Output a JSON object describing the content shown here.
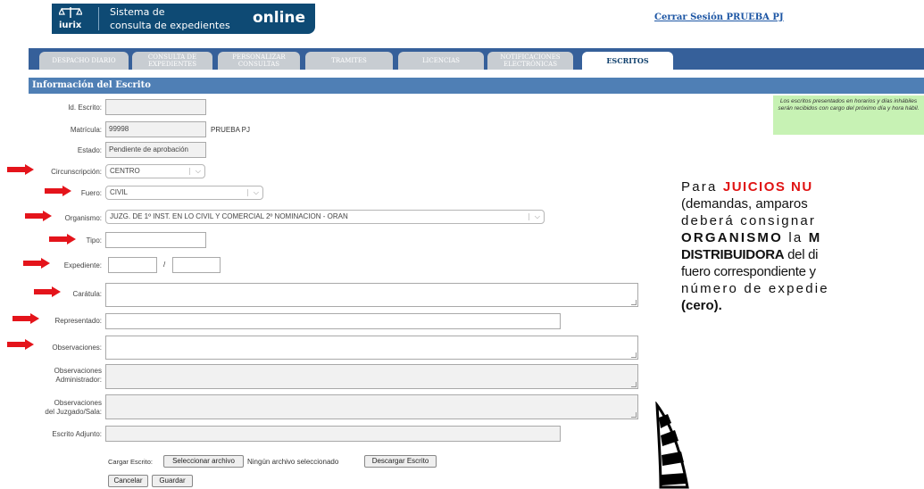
{
  "header": {
    "logo_word": "iurix",
    "subtitle_line1": "Sistema de",
    "subtitle_line2": "consulta de expedientes",
    "online": "online",
    "logout": "Cerrar Sesión PRUEBA PJ"
  },
  "tabs": [
    {
      "label": "DESPACHO DIARIO"
    },
    {
      "label": "CONSULTA DE EXPEDIENTES"
    },
    {
      "label": "PERSONALIZAR CONSULTAS"
    },
    {
      "label": "TRAMITES"
    },
    {
      "label": "LICENCIAS"
    },
    {
      "label": "NOTIFICACIONES ELECTRÓNICAS"
    },
    {
      "label": "ESCRITOS",
      "active": true
    }
  ],
  "section_title": "Información del Escrito",
  "notice": "Los escritos presentados en horarios y días inhábiles serán recibidos con cargo del próximo día y hora hábil.",
  "form": {
    "id_escrito": {
      "label": "Id. Escrito:",
      "value": ""
    },
    "matricula": {
      "label": "Matrícula:",
      "value": "99998",
      "name": "PRUEBA PJ"
    },
    "estado": {
      "label": "Estado:",
      "value": "Pendiente de aprobación"
    },
    "circunscripcion": {
      "label": "Circunscripción:",
      "value": "CENTRO"
    },
    "fuero": {
      "label": "Fuero:",
      "value": "CIVIL"
    },
    "organismo": {
      "label": "Organismo:",
      "value": "JUZG. DE 1º INST. EN LO CIVIL Y COMERCIAL 2º NOMINACION - ORAN"
    },
    "tipo": {
      "label": "Tipo:",
      "value": ""
    },
    "expediente": {
      "label": "Expediente:",
      "separator": "/",
      "number": "",
      "year": ""
    },
    "caratula": {
      "label": "Carátula:"
    },
    "representado": {
      "label": "Representado:"
    },
    "observaciones": {
      "label": "Observaciones:"
    },
    "obs_admin": {
      "label_line1": "Observaciones",
      "label_line2": "Administrador:"
    },
    "obs_juzgado": {
      "label_line1": "Observaciones",
      "label_line2": "del Juzgado/Sala:"
    },
    "escrito_adjunto": {
      "label": "Escrito Adjunto:"
    },
    "cargar": {
      "label": "Cargar Escrito:",
      "select_button": "Seleccionar archivo",
      "no_file": "Ningún archivo seleccionado",
      "download_button": "Descargar Escrito"
    },
    "cancel_button": "Cancelar",
    "save_button": "Guardar"
  },
  "overlay": {
    "l1a": "Para ",
    "l1b": "JUICIOS NU",
    "l2": "(demandas, amparos",
    "l3": "deberá consignar",
    "l4a": "ORGANISMO",
    "l4b": " la ",
    "l4c": "M",
    "l5a": "DISTRIBUIDORA",
    "l5b": " del di",
    "l6": "fuero correspondiente y",
    "l7": "número de expedie",
    "l8": "(cero)."
  },
  "colors": {
    "header_blue": "#0e4a74",
    "tab_bar": "#36609a",
    "section_header": "#4f7fb5",
    "arrow_red": "#e4141b",
    "notice_green": "#c7f2b4"
  }
}
